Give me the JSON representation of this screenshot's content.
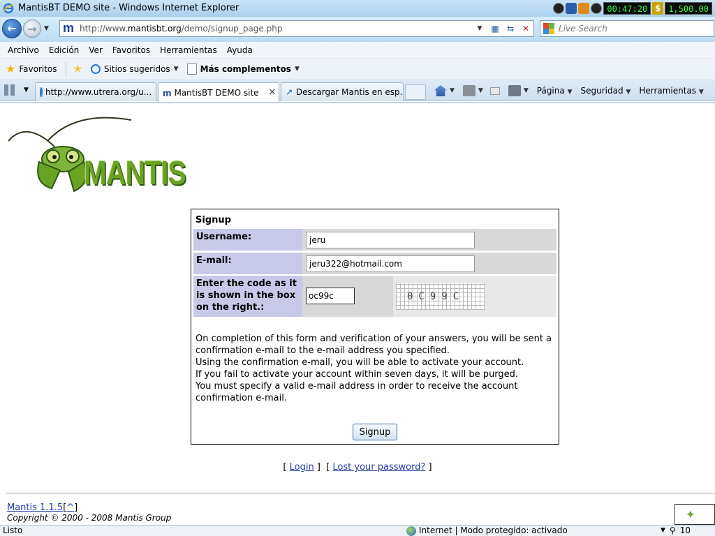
{
  "window": {
    "title": "MantisBT DEMO site - Windows Internet Explorer",
    "tray_timer": "00:47:20",
    "tray_dollar": "$",
    "tray_amount": "1,500.00"
  },
  "address_bar": {
    "url_prefix": "http://www.",
    "url_domain": "mantisbt.org",
    "url_path": "/demo/signup_page.php",
    "search_placeholder": "Live Search"
  },
  "menu": [
    "Archivo",
    "Edición",
    "Ver",
    "Favoritos",
    "Herramientas",
    "Ayuda"
  ],
  "favorites_bar": {
    "favorites": "Favoritos",
    "suggested": "Sitios sugeridos",
    "addons": "Más complementos"
  },
  "tabs": [
    {
      "label": "http://www.utrera.org/u...",
      "active": false
    },
    {
      "label": "MantisBT DEMO site",
      "active": true
    },
    {
      "label": "Descargar Mantis en esp...",
      "active": false
    }
  ],
  "command_bar": {
    "page": "Página",
    "security": "Seguridad",
    "tools": "Herramientas"
  },
  "logo_text": "MANTIS",
  "form": {
    "heading": "Signup",
    "username_label": "Username:",
    "username_value": "jeru",
    "email_label": "E-mail:",
    "email_value": "jeru322@hotmail.com",
    "code_label": "Enter the code as it is shown in the box on the right.:",
    "code_value": "oc99c",
    "captcha_text": "0C99C",
    "info_lines": [
      "On completion of this form and verification of your answers, you will be sent a confirmation e-mail to the e-mail address you specified.",
      "Using the confirmation e-mail, you will be able to activate your account.",
      "If you fail to activate your account within seven days, it will be purged.",
      "You must specify a valid e-mail address in order to receive the account confirmation e-mail."
    ],
    "submit_label": "Signup"
  },
  "links": {
    "login": "Login",
    "lost_password": "Lost your password?"
  },
  "footer": {
    "version_link": "Mantis 1.1.5",
    "caret": "^",
    "copyright": "Copyright © 2000 - 2008 Mantis Group"
  },
  "status_bar": {
    "left": "Listo",
    "zone": "Internet | Modo protegido: activado",
    "zoom": "10"
  }
}
